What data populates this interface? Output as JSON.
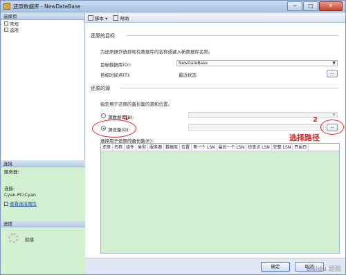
{
  "window": {
    "title": "还原数据库 - NewDateBase",
    "min": "─",
    "max": "□",
    "close": "✕"
  },
  "left": {
    "header": "选择页",
    "pages": [
      "常规",
      "选项"
    ],
    "connection": {
      "header": "连接",
      "server_label": "服务器:",
      "server_value": "",
      "conn_label": "连接:",
      "conn_value": "Cyan-PC\\Cyan",
      "link": "查看连接属性"
    },
    "progress": {
      "header": "进度",
      "status": "就绪"
    }
  },
  "toolbar": {
    "script": "脚本 ▾",
    "help": "帮助"
  },
  "restore_target": {
    "title": "还原的目标",
    "desc": "为还原操作选择现有数据库的名称或键入新数据库名称。",
    "db_label": "目标数据库(O):",
    "db_value": "NewDateBase",
    "time_label": "目标时间点(T):",
    "time_value": "最近状态",
    "time_btn": "..."
  },
  "restore_source": {
    "title": "还原的源",
    "desc": "指定用于还原的备份集的源和位置。",
    "from_db_label": "源数据库(B):",
    "from_device_label": "源设备(D):",
    "device_btn": "..."
  },
  "annotations": {
    "one": "1",
    "two": "2",
    "choose_path": "选择路径"
  },
  "backup_sets": {
    "label": "选择用于还原的备份集(E):",
    "columns": [
      "还原",
      "名称",
      "组件",
      "类型",
      "服务器",
      "数据库",
      "位置",
      "第一个 LSN",
      "最后一个 LSN",
      "检查点 LSN",
      "完整 LSN",
      "开始日"
    ]
  },
  "footer": {
    "ok": "确定",
    "cancel": "取消"
  },
  "watermark": "Baidu 经验"
}
